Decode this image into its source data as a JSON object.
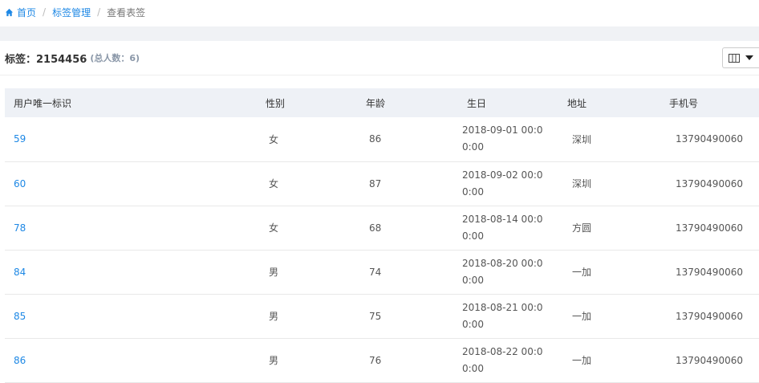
{
  "breadcrumb": {
    "home": "首页",
    "tag_mgmt": "标签管理",
    "current": "查看表签"
  },
  "header": {
    "title": "标签：2154456",
    "count": "(总人数：6)"
  },
  "table": {
    "columns": [
      "用户唯一标识",
      "性别",
      "年龄",
      "生日",
      "地址",
      "手机号"
    ],
    "rows": [
      {
        "id": "59",
        "sex": "女",
        "age": "86",
        "birthday": "2018-09-01 00:00:00",
        "address": "深圳",
        "phone": "13790490060"
      },
      {
        "id": "60",
        "sex": "女",
        "age": "87",
        "birthday": "2018-09-02 00:00:00",
        "address": "深圳",
        "phone": "13790490060"
      },
      {
        "id": "78",
        "sex": "女",
        "age": "68",
        "birthday": "2018-08-14 00:00:00",
        "address": "方圆",
        "phone": "13790490060"
      },
      {
        "id": "84",
        "sex": "男",
        "age": "74",
        "birthday": "2018-08-20 00:00:00",
        "address": "一加",
        "phone": "13790490060"
      },
      {
        "id": "85",
        "sex": "男",
        "age": "75",
        "birthday": "2018-08-21 00:00:00",
        "address": "一加",
        "phone": "13790490060"
      },
      {
        "id": "86",
        "sex": "男",
        "age": "76",
        "birthday": "2018-08-22 00:00:00",
        "address": "一加",
        "phone": "13790490060"
      }
    ]
  },
  "colors": {
    "link": "#1e88e5",
    "header_bg": "#eef1f6"
  }
}
